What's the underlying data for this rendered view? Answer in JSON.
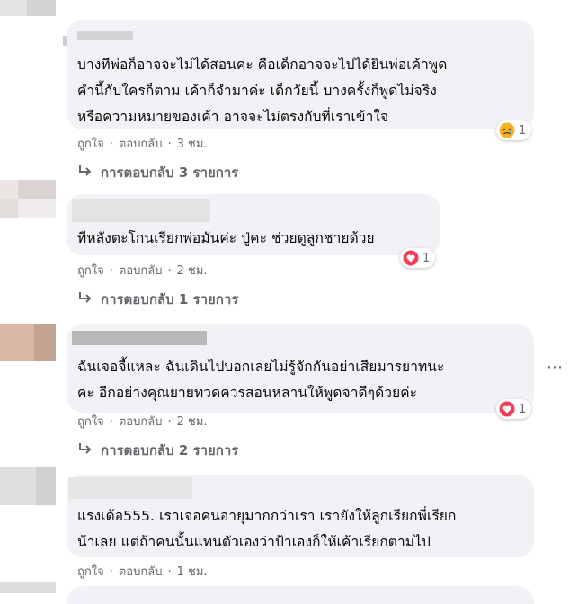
{
  "comments": [
    {
      "lines": [
        "บางทีพ่อก็อาจจะไม่ได้สอนค่ะ คือเด็กอาจจะไปได้ยินพ่อเค้าพูด",
        "คำนี้กับใครก็ตาม เค้าก็จำมาค่ะ เด็กวัยนี้ บางครั้งก็พูดไม่จริง",
        "หรือความหมายของเค้า อาจจะไม่ตรงกับที่เราเข้าใจ"
      ],
      "like": "ถูกใจ",
      "reply": "ตอบกลับ",
      "time": "3 ชม.",
      "reaction": {
        "icon": "sad-emoji-icon",
        "count": "1"
      },
      "replies": "การตอบกลับ 3 รายการ"
    },
    {
      "lines": [
        "ทีหลังตะโกนเรียกพ่อมันค่ะ ปู่คะ ช่วยดูลูกชายด้วย"
      ],
      "like": "ถูกใจ",
      "reply": "ตอบกลับ",
      "time": "2 ชม.",
      "reaction": {
        "icon": "heart-icon",
        "count": "1"
      },
      "replies": "การตอบกลับ 1 รายการ"
    },
    {
      "lines": [
        "ฉันเจอจี้แหละ ฉันเดินไปบอกเลยไม่รู้จักกันอย่าเสียมารยาทนะ",
        "คะ อีกอย่างคุณยายทวดควรสอนหลานให้พูดจาดีๆด้วยค่ะ"
      ],
      "like": "ถูกใจ",
      "reply": "ตอบกลับ",
      "time": "2 ชม.",
      "reaction": {
        "icon": "heart-icon",
        "count": "1"
      },
      "replies": "การตอบกลับ 2 รายการ"
    },
    {
      "lines": [
        "แรงเด้อ555. เราเจอคนอายุมากกว่าเรา เรายังให้ลูกเรียกพี่เรียก",
        "น้าเลย แต่ถ้าคนนั้นแทนตัวเองว่าป้าเองก็ให้เค้าเรียกตามไป"
      ],
      "like": "ถูกใจ",
      "reply": "ตอบกลับ",
      "time": "1 ชม."
    }
  ],
  "more_options_icon": "more-options-icon",
  "colors": {
    "bubble": "#f0f2f5",
    "meta": "#65676b",
    "heart": "#f33e58",
    "sad": "#f7b125"
  }
}
